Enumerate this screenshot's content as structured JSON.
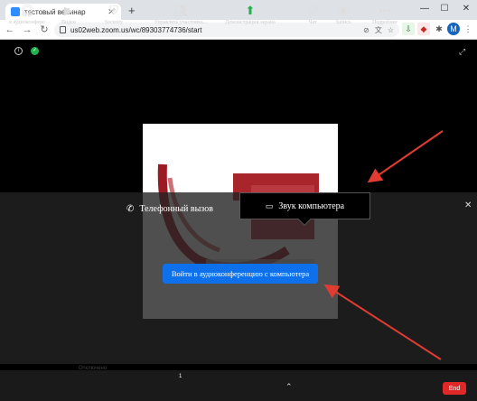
{
  "browser": {
    "tab_title": "тестовый вебинар",
    "tab_close": "✕",
    "new_tab": "+",
    "url": "us02web.zoom.us/wc/89303774736/start",
    "win_min": "—",
    "win_max": "☐",
    "win_close": "✕",
    "profile_initial": "M"
  },
  "meeting": {
    "info_icon_glyph": "i",
    "shield_glyph": "✓",
    "fullscreen_glyph": "⤢"
  },
  "audio_dialog": {
    "tab_phone_label": "Телефонный вызов",
    "tab_computer_label": "Звук компьютера",
    "join_button_label": "Войти в аудиоконференцию с компьютера",
    "close_glyph": "✕"
  },
  "controls": {
    "audio_label": "к аудиоконфере",
    "video_label": "Видео",
    "security_label": "Security",
    "participants_label": "Управлять участника...",
    "participants_count": "1",
    "share_label": "Демонстрация экрана",
    "chat_label": "Чат",
    "record_label": "Запись",
    "more_label": "Подробнее",
    "end_label": "End",
    "hint_text": "Отключено"
  },
  "colors": {
    "accent_blue": "#0e71eb",
    "end_red": "#e02828",
    "arrow_red": "#e03c31",
    "share_green": "#22b14c"
  }
}
